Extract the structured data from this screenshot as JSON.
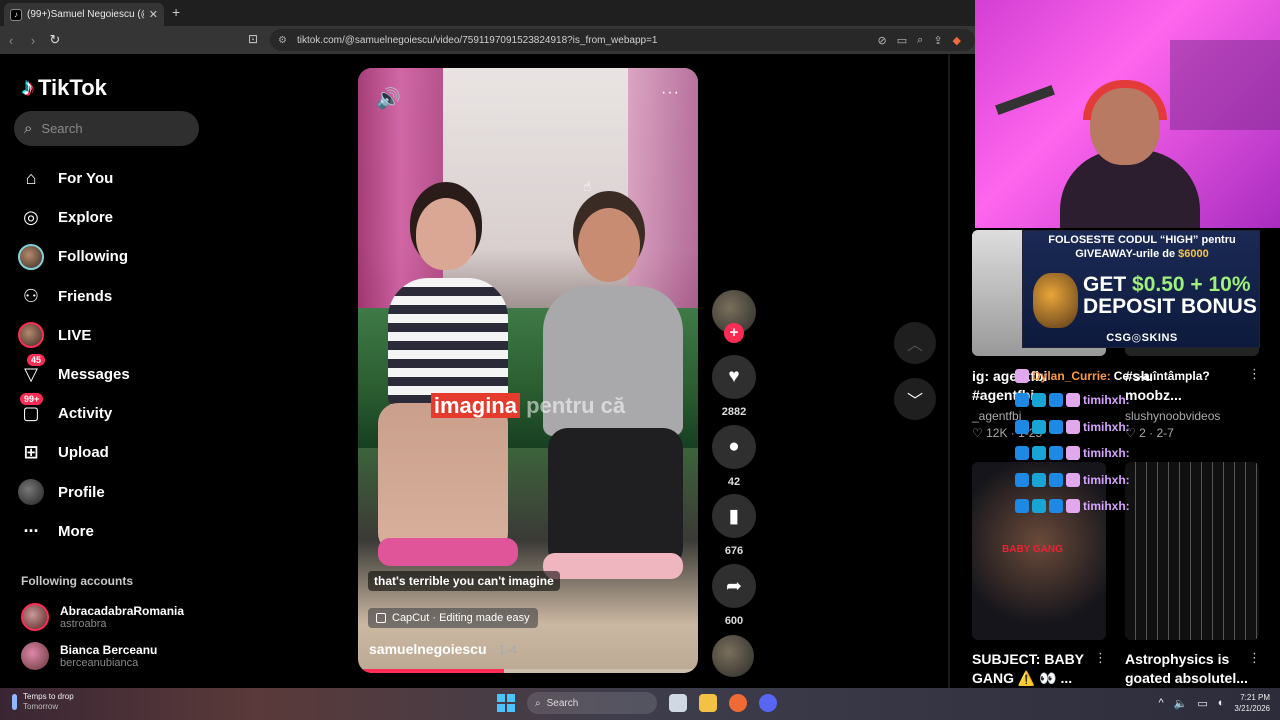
{
  "browser": {
    "tab_title": "(99+)Samuel Negoiescu (@s",
    "tab_close": "✕",
    "new_tab": "+",
    "url": "tiktok.com/@samuelnegoiescu/video/7591197091523824918?is_from_webapp=1"
  },
  "sidebar": {
    "logo": "TikTok",
    "search_placeholder": "Search",
    "nav": [
      {
        "label": "For You",
        "icon": "home-icon"
      },
      {
        "label": "Explore",
        "icon": "compass-icon"
      },
      {
        "label": "Following",
        "icon": "avatar-icon"
      },
      {
        "label": "Friends",
        "icon": "friends-icon"
      },
      {
        "label": "LIVE",
        "icon": "live-avatar-icon"
      },
      {
        "label": "Messages",
        "icon": "inbox-icon",
        "badge": "45"
      },
      {
        "label": "Activity",
        "icon": "activity-icon",
        "badge": "99+"
      },
      {
        "label": "Upload",
        "icon": "upload-icon"
      },
      {
        "label": "Profile",
        "icon": "profile-avatar-icon"
      },
      {
        "label": "More",
        "icon": "more-icon"
      }
    ],
    "following_header": "Following accounts",
    "accounts": [
      {
        "name": "AbracadabraRomania",
        "handle": "astroabra"
      },
      {
        "name": "Bianca Berceanu",
        "handle": "berceanubianca"
      }
    ]
  },
  "video": {
    "caption_highlight": "imagina",
    "caption_rest": "pentru că",
    "subtitle": "that's terrible you can't imagine",
    "capcut": "CapCut · Editing made easy",
    "author": "samuelnegoiescu",
    "date": "1-4",
    "progress": 0.43
  },
  "actions": {
    "likes": "2882",
    "comments": "42",
    "saves": "676",
    "shares": "600"
  },
  "overlay": {
    "ad_line1": "FOLOSESTE CODUL “HIGH” pentru",
    "ad_line2_pre": "GIVEAWAY-urile de ",
    "ad_line2_amt": "$6000",
    "ad_big1_a": "GET ",
    "ad_big1_b": "$0.50 + 10%",
    "ad_big2": "DEPOSIT BONUS",
    "ad_brand": "CSG◎SKINS",
    "chat": [
      {
        "name": "Dylan_Currie:",
        "text": "Ce s-a întâmpla?"
      },
      {
        "name": "timihxh:",
        "text": ""
      },
      {
        "name": "timihxh:",
        "text": ""
      },
      {
        "name": "timihxh:",
        "text": ""
      },
      {
        "name": "timihxh:",
        "text": ""
      },
      {
        "name": "timihxh:",
        "text": ""
      }
    ]
  },
  "recommended": [
    {
      "title1": "ig: agentfbi",
      "title2": "#agentfbi",
      "handle": "_agentfbi",
      "likes": "12K",
      "date": "1-25"
    },
    {
      "title1": "#slu",
      "title2": "moobz...",
      "handle": "slushynoobvideos",
      "likes": "2",
      "date": "2-7"
    },
    {
      "title1": "SUBJECT: BABY",
      "title2": "GANG ⚠️ 👀 ..."
    },
    {
      "title1": "Astrophysics is",
      "title2": "goated absolutel..."
    }
  ],
  "thumb_overlay_text": "BABY GANG",
  "taskbar": {
    "weather_line1": "Temps to drop",
    "weather_line2": "Tomorrow",
    "search": "Search",
    "time": "7:21 PM",
    "date": "3/21/2026"
  }
}
